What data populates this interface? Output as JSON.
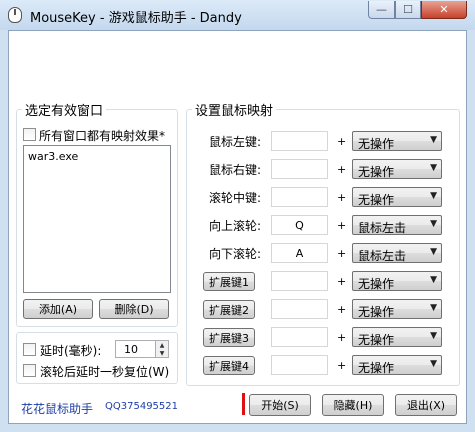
{
  "window": {
    "title": "MouseKey - 游戏鼠标助手 - Dandy",
    "controls": {
      "minimize": "—",
      "maximize": "☐",
      "close": "✕"
    }
  },
  "left_group": {
    "title": "选定有效窗口",
    "all_windows_checkbox": {
      "label": "所有窗口都有映射效果*",
      "checked": false
    },
    "window_list": [
      "war3.exe"
    ],
    "add_button": "添加(A)",
    "delete_button": "删除(D)"
  },
  "delay_group": {
    "delay_checkbox": {
      "label": "延时(毫秒):",
      "checked": false
    },
    "delay_value": "10",
    "reset_checkbox": {
      "label": "滚轮后延时一秒复位(W)",
      "checked": false
    }
  },
  "mapping": {
    "title": "设置鼠标映射",
    "plus": "+",
    "rows": [
      {
        "label": "鼠标左键:",
        "key": "",
        "action": "无操作"
      },
      {
        "label": "鼠标右键:",
        "key": "",
        "action": "无操作"
      },
      {
        "label": "滚轮中键:",
        "key": "",
        "action": "无操作"
      },
      {
        "label": "向上滚轮:",
        "key": "Q",
        "action": "鼠标左击"
      },
      {
        "label": "向下滚轮:",
        "key": "A",
        "action": "鼠标左击"
      }
    ],
    "ext_rows": [
      {
        "button": "扩展键1",
        "key": "",
        "action": "无操作"
      },
      {
        "button": "扩展键2",
        "key": "",
        "action": "无操作"
      },
      {
        "button": "扩展键3",
        "key": "",
        "action": "无操作"
      },
      {
        "button": "扩展键4",
        "key": "",
        "action": "无操作"
      }
    ]
  },
  "footer": {
    "app_name": "花花鼠标助手",
    "qq": "QQ375495521",
    "start_button": "开始(S)",
    "hide_button": "隐藏(H)",
    "exit_button": "退出(X)"
  }
}
